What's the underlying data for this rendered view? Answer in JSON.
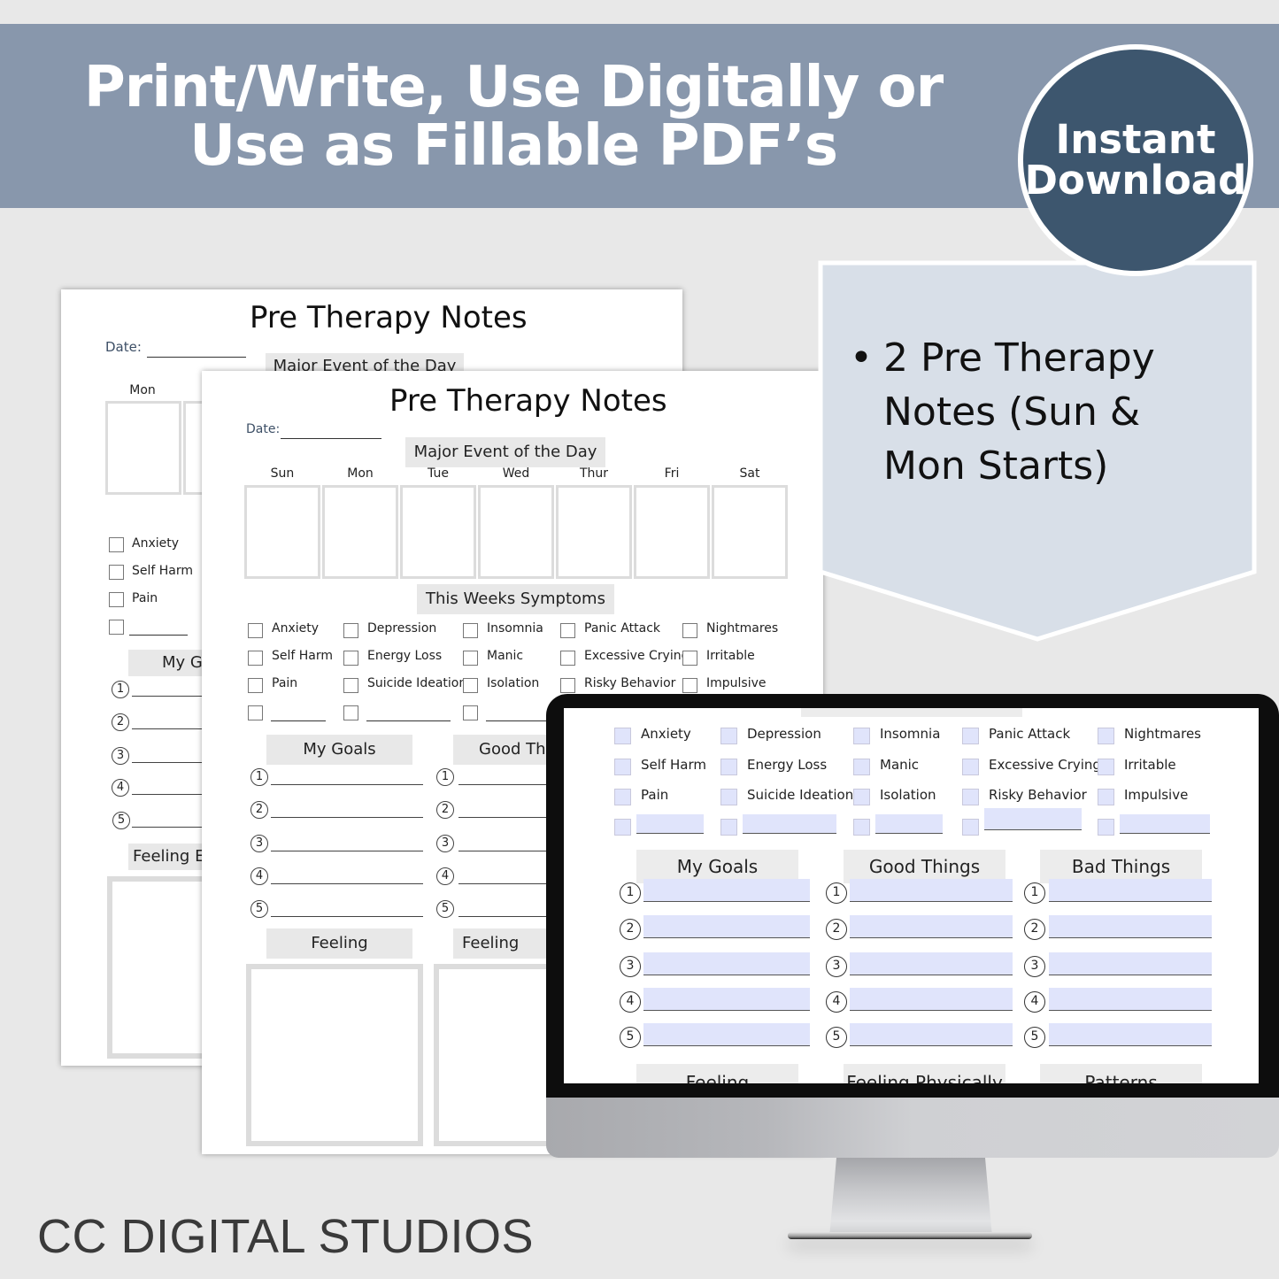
{
  "banner": {
    "title_line1": "Print/Write, Use Digitally or",
    "title_line2": "Use as Fillable PDF’s",
    "bg_color": "#8897ac"
  },
  "badge": {
    "line1": "Instant",
    "line2": "Download",
    "bg_color": "#3d566e"
  },
  "callout": {
    "bullet": "•",
    "lines": [
      "2 Pre Therapy",
      "Notes (Sun &",
      "Mon Starts)"
    ],
    "bg_color": "#d8dfe8"
  },
  "back_page": {
    "title": "Pre Therapy Notes",
    "date_label": "Date:",
    "major_event": "Major Event of the Day",
    "first_day": "Mon",
    "symptoms": [
      "Anxiety",
      "Self Harm",
      "Pain"
    ],
    "goals_head": "My G",
    "numbers": [
      "1",
      "2",
      "3",
      "4",
      "5"
    ],
    "feeling_head": "Feeling Er"
  },
  "front_page": {
    "title": "Pre Therapy Notes",
    "date_label": "Date:",
    "major_event": "Major Event of the Day",
    "days": [
      "Sun",
      "Mon",
      "Tue",
      "Wed",
      "Thur",
      "Fri",
      "Sat"
    ],
    "symptoms_head": "This Weeks Symptoms",
    "symptom_columns": [
      [
        "Anxiety",
        "Self Harm",
        "Pain"
      ],
      [
        "Depression",
        "Energy Loss",
        "Suicide Ideation"
      ],
      [
        "Insomnia",
        "Manic",
        "Isolation"
      ],
      [
        "Panic Attack",
        "Excessive Crying",
        "Risky Behavior"
      ],
      [
        "Nightmares",
        "Irritable",
        "Impulsive"
      ]
    ],
    "goals_head": "My Goals",
    "good_head": "Good Thi",
    "numbers": [
      "1",
      "2",
      "3",
      "4",
      "5"
    ],
    "feeling_emotionally": "Feeling Emotionally",
    "feeling_physically": "Feeling Phys"
  },
  "screen": {
    "symptom_columns": [
      [
        "Anxiety",
        "Self Harm",
        "Pain"
      ],
      [
        "Depression",
        "Energy Loss",
        "Suicide Ideation"
      ],
      [
        "Insomnia",
        "Manic",
        "Isolation"
      ],
      [
        "Panic Attack",
        "Excessive Crying",
        "Risky Behavior"
      ],
      [
        "Nightmares",
        "Irritable",
        "Impulsive"
      ]
    ],
    "list_heads": [
      "My Goals",
      "Good Things",
      "Bad Things"
    ],
    "numbers": [
      "1",
      "2",
      "3",
      "4",
      "5"
    ],
    "bottom_heads": [
      "Feeling Emotionally",
      "Feeling Physically",
      "Patterns"
    ],
    "field_color": "#e0e4fb"
  },
  "brand": "CC DIGITAL STUDIOS"
}
